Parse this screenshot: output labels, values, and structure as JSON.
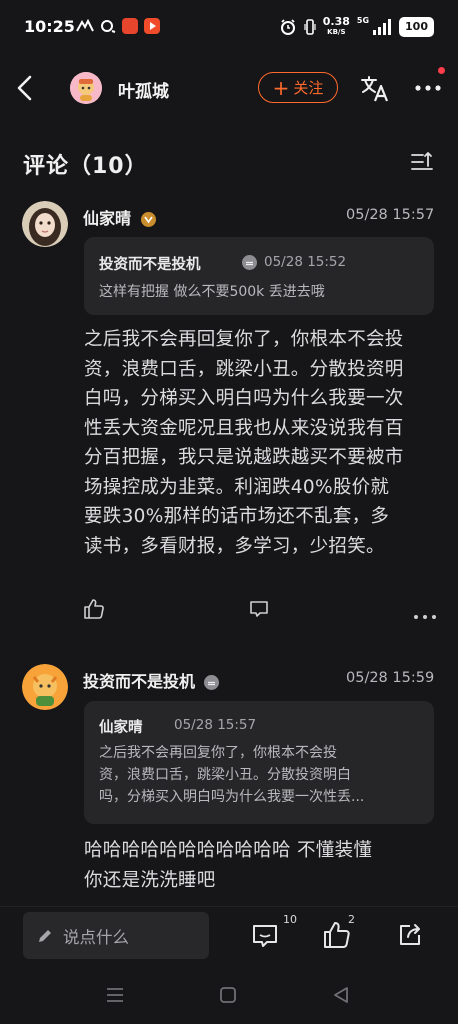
{
  "status_bar": {
    "time": "10:25",
    "net_speed": "0.38",
    "net_unit": "KB/S",
    "signal": "5G",
    "battery": "100"
  },
  "header": {
    "username": "叶孤城",
    "follow_label": "关注",
    "follow_plus": "+"
  },
  "comments_header": {
    "title": "评论（10）"
  },
  "comments": [
    {
      "author": "仙家晴",
      "time": "05/28 15:57",
      "quote": {
        "author": "投资而不是投机",
        "time": "05/28 15:52",
        "text": "这样有把握 做么不要500k 丢进去哦"
      },
      "body_lines": [
        "之后我不会再回复你了，你根本不会投",
        "资，浪费口舌，跳梁小丑。分散投资明",
        "白吗，分梯买入明白吗为什么我要一次",
        "性丢大资金呢况且我也从来没说我有百",
        "分百把握，我只是说越跌越买不要被市",
        "场操控成为韭菜。利润跌40%股价就",
        "要跌30%那样的话市场还不乱套，多",
        "读书，多看财报，多学习，少招笑。"
      ]
    },
    {
      "author": "投资而不是投机",
      "time": "05/28 15:59",
      "quote": {
        "author": "仙家晴",
        "time": "05/28 15:57",
        "text_lines": [
          "之后我不会再回复你了，你根本不会投",
          "资，浪费口舌，跳梁小丑。分散投资明白",
          "吗，分梯买入明白吗为什么我要一次性丢..."
        ]
      },
      "body_lines": [
        "哈哈哈哈哈哈哈哈哈哈哈 不懂装懂",
        "你还是洗洗睡吧"
      ]
    }
  ],
  "bottom_bar": {
    "input_placeholder": "说点什么",
    "comment_count": "10",
    "like_count": "2"
  },
  "colors": {
    "background": "#161618",
    "accent": "#ff6a2c",
    "quote_bg": "#262629"
  }
}
